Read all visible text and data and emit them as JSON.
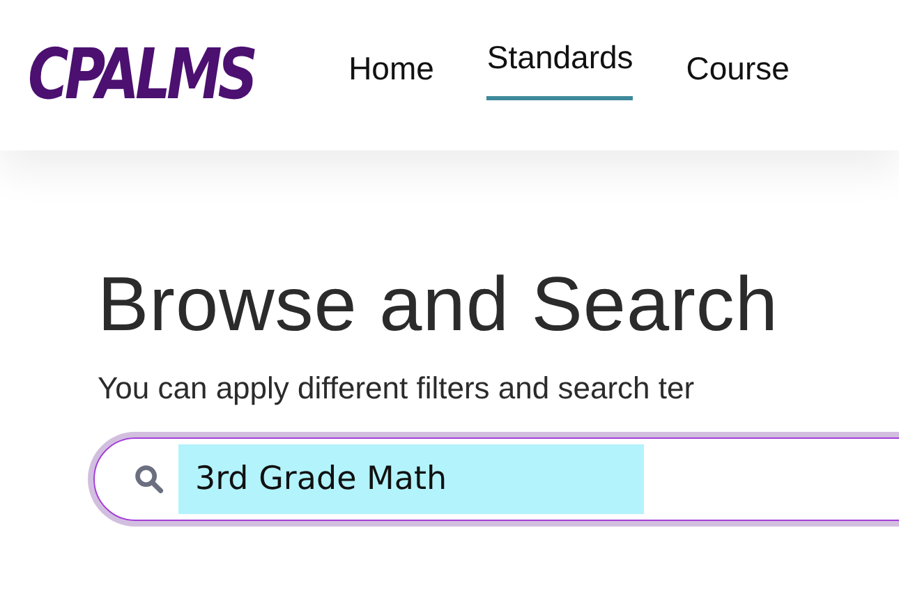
{
  "header": {
    "logo": "CPALMS",
    "nav": [
      {
        "label": "Home",
        "selected": false
      },
      {
        "label": "Standards",
        "selected": true
      },
      {
        "label": "Course",
        "selected": false
      }
    ]
  },
  "main": {
    "title": "Browse and Search",
    "subtitle": "You can apply different filters and search ter",
    "search": {
      "value": "3rd Grade Math"
    }
  }
}
